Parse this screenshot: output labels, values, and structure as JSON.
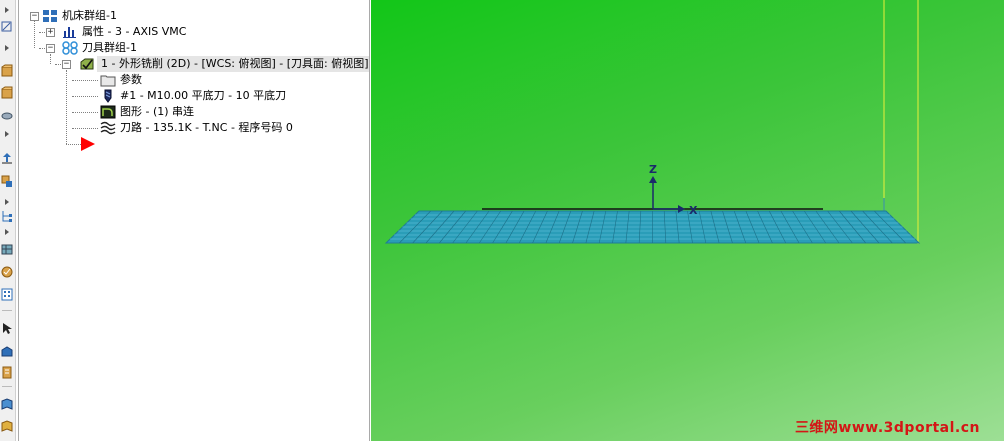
{
  "tree": {
    "items": [
      {
        "label": "机床群组-1",
        "icon": "machine-group-icon",
        "expander": "−"
      },
      {
        "label": "属性 - 3 - AXIS VMC",
        "icon": "properties-icon",
        "expander": "+"
      },
      {
        "label": "刀具群组-1",
        "icon": "toolgroup-icon",
        "expander": "−"
      },
      {
        "label": "1 - 外形铣削 (2D) - [WCS: 俯视图] - [刀具面: 俯视图]",
        "icon": "operation-icon",
        "expander": "−"
      },
      {
        "label": "参数",
        "icon": "folder-icon"
      },
      {
        "label": "#1 - M10.00 平底刀 - 10 平底刀",
        "icon": "tool-icon"
      },
      {
        "label": "图形 - (1) 串连",
        "icon": "geometry-icon"
      },
      {
        "label": "刀路 - 135.1K - T.NC - 程序号码 0",
        "icon": "toolpath-icon"
      }
    ]
  },
  "viewport": {
    "axis_z": "Z",
    "axis_x": "X",
    "watermark": "三维网www.3dportal.cn"
  },
  "colors": {
    "viewport_top": "#12c618",
    "viewport_bottom": "#9ddf95",
    "part_mesh": "#2a9db8",
    "selection": "#e5e5e5",
    "insert_arrow": "#ff0000",
    "watermark": "#d41616"
  }
}
